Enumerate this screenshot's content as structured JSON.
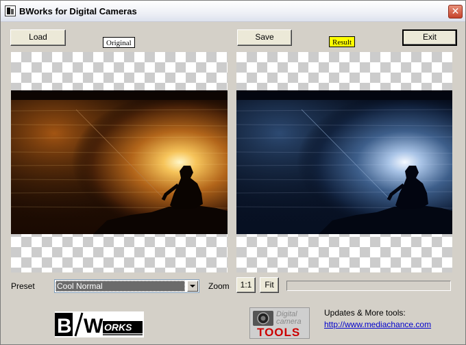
{
  "window": {
    "title": "BWorks for Digital Cameras",
    "close_symbol": "✕"
  },
  "toolbar": {
    "load_label": "Load",
    "save_label": "Save",
    "exit_label": "Exit",
    "original_label": "Original",
    "result_label": "Result"
  },
  "controls": {
    "preset_label": "Preset",
    "preset_value": "Cool Normal",
    "zoom_label": "Zoom",
    "zoom_1to1_label": "1:1",
    "zoom_fit_label": "Fit",
    "progress": 0
  },
  "footer": {
    "updates_text": "Updates & More tools:",
    "link_text": "http://www.mediachance.com",
    "bworks_logo_text": "BWORKS",
    "tools_logo_line1": "Digital",
    "tools_logo_line2": "camera",
    "tools_logo_line3": "TOOLS"
  },
  "colors": {
    "window_bg": "#d4d0c8",
    "result_label_bg": "#ffff00",
    "original_label_bg": "#ffffff",
    "link_color": "#0000cc",
    "tools_text_red": "#cc0000"
  }
}
